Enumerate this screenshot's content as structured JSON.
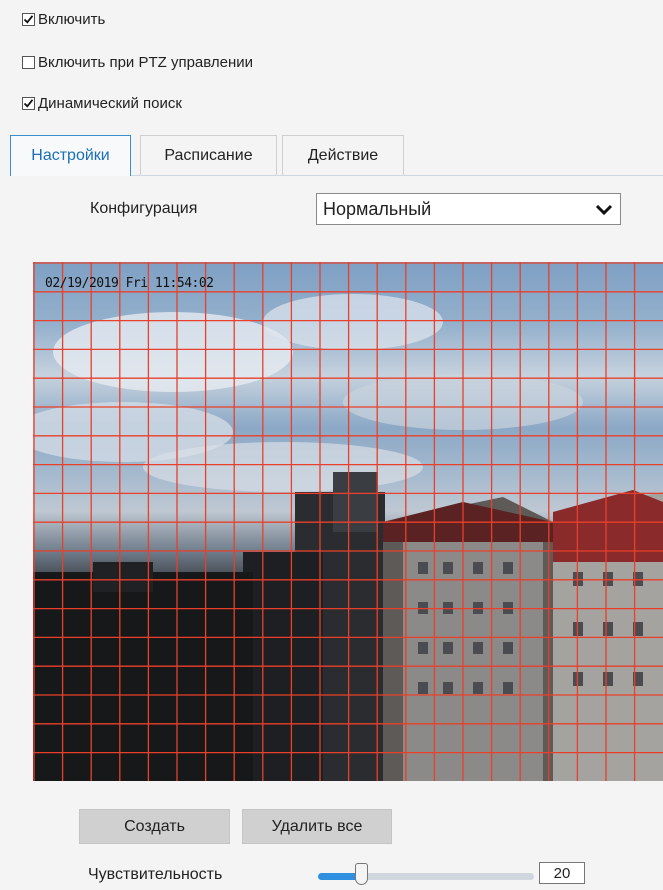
{
  "options": {
    "enable": {
      "label": "Включить",
      "checked": true
    },
    "enable_ptz": {
      "label": "Включить при PTZ управлении",
      "checked": false
    },
    "dynamic_search": {
      "label": "Динамический поиск",
      "checked": true
    }
  },
  "tabs": [
    {
      "label": "Настройки",
      "active": true
    },
    {
      "label": "Расписание",
      "active": false
    },
    {
      "label": "Действие",
      "active": false
    }
  ],
  "config": {
    "label": "Конфигурация",
    "value": "Нормальный"
  },
  "video": {
    "timestamp": "02/19/2019 Fri 11:54:02",
    "grid_color": "#e8402a"
  },
  "buttons": {
    "create": "Создать",
    "delete_all": "Удалить все"
  },
  "sensitivity": {
    "label": "Чувствительность",
    "value": "20",
    "fraction": 0.2
  },
  "colors": {
    "accent": "#2f8fe0",
    "tab_active": "#1a6fb8"
  }
}
